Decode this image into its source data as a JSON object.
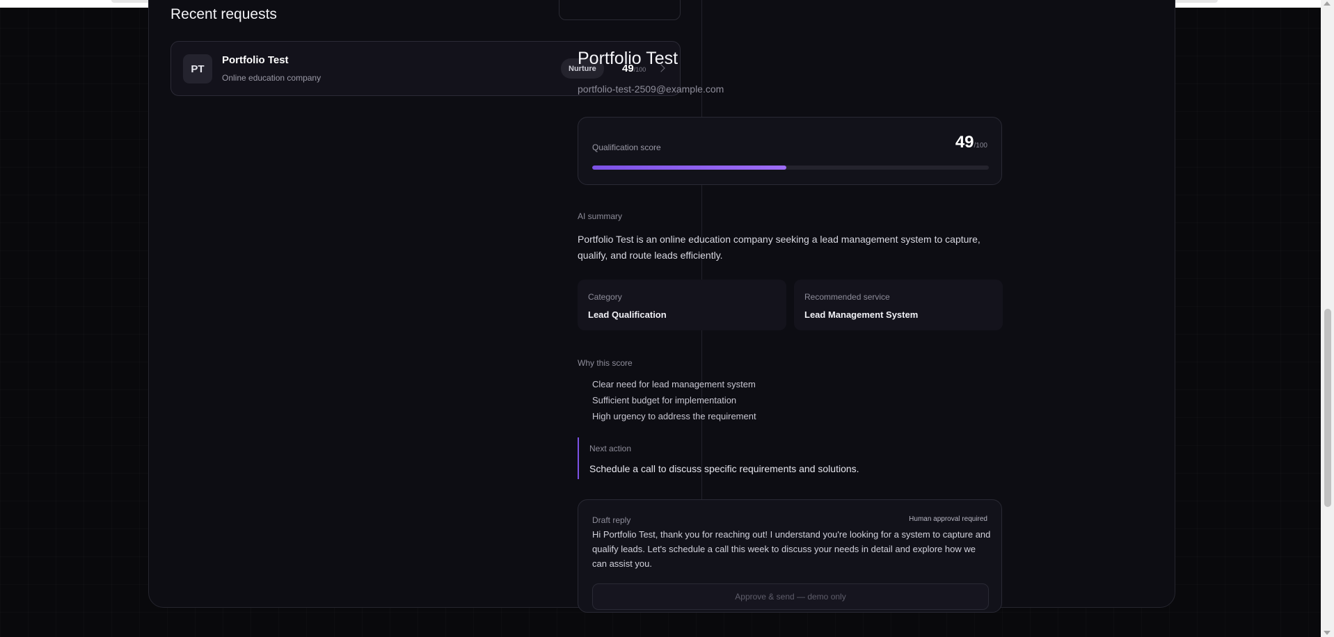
{
  "requests": {
    "title": "Recent requests",
    "items": [
      {
        "initials": "PT",
        "name": "Portfolio Test",
        "description": "Online education company",
        "badge": "Nurture",
        "score": "49",
        "score_max": "/100"
      }
    ]
  },
  "detail": {
    "name": "Portfolio Test",
    "email": "portfolio-test-2509@example.com",
    "qualification": {
      "label": "Qualification score",
      "score": "49",
      "score_max": "/100",
      "progress_percent": 49,
      "accent_color": "#8b5cf6"
    },
    "summary": {
      "label": "AI summary",
      "text": "Portfolio Test is an online education company seeking a lead management system to capture, qualify, and route leads efficiently."
    },
    "category": {
      "label": "Category",
      "value": "Lead Qualification"
    },
    "recommended": {
      "label": "Recommended service",
      "value": "Lead Management System"
    },
    "why": {
      "label": "Why this score",
      "reasons": [
        "Clear need for lead management system",
        "Sufficient budget for implementation",
        "High urgency to address the requirement"
      ]
    },
    "next_action": {
      "label": "Next action",
      "text": "Schedule a call to discuss specific requirements and solutions."
    },
    "draft": {
      "label": "Draft reply",
      "flag": "Human approval required",
      "text": "Hi Portfolio Test, thank you for reaching out! I understand you're looking for a system to capture and qualify leads. Let's schedule a call this week to discuss your needs in detail and explore how we can assist you.",
      "button_label": "Approve & send — demo only"
    }
  }
}
